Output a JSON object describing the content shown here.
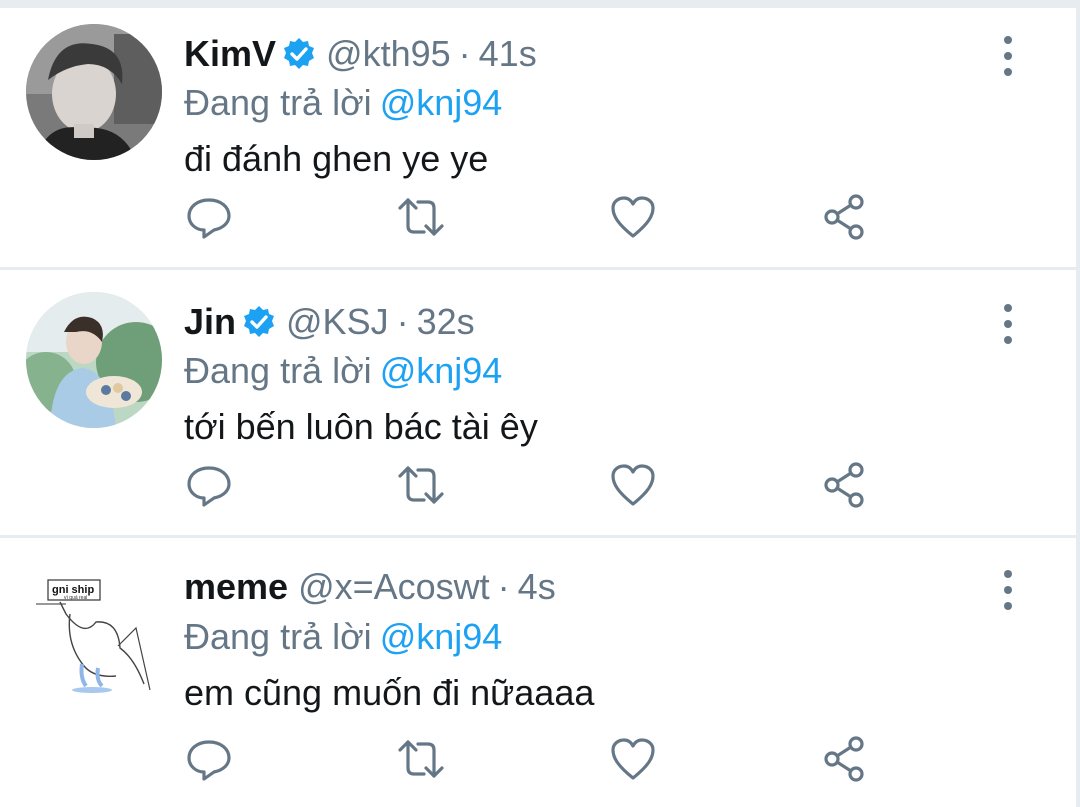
{
  "tweets": [
    {
      "name": "KimV",
      "verified": true,
      "handle": "@kth95",
      "separator": "·",
      "time": "41s",
      "reply_prefix": "Đang trả lời",
      "reply_to": "@knj94",
      "text": "đi đánh ghen ye ye",
      "avatar_icon": "avatar-photo-kimv"
    },
    {
      "name": "Jin",
      "verified": true,
      "handle": "@KSJ",
      "separator": "·",
      "time": "32s",
      "reply_prefix": "Đang trả lời",
      "reply_to": "@knj94",
      "text": "tới bến luôn bác tài êy",
      "avatar_icon": "avatar-photo-jin"
    },
    {
      "name": "meme",
      "verified": false,
      "handle": "@x=Acoswt",
      "separator": "·",
      "time": "4s",
      "reply_prefix": "Đang trả lời",
      "reply_to": "@knj94",
      "text": "em cũng muốn đi nữaaaa",
      "avatar_icon": "avatar-meme-drawing",
      "avatar_sign_text": "gni ship",
      "avatar_sign_subtext": "vì quá real"
    }
  ],
  "actions": [
    "reply-icon",
    "retweet-icon",
    "like-icon",
    "share-icon"
  ],
  "colors": {
    "accent": "#1da1f2",
    "verified": "#1da1f2",
    "secondary_text": "#657786",
    "primary_text": "#14171a",
    "divider": "#e6ecf0"
  }
}
